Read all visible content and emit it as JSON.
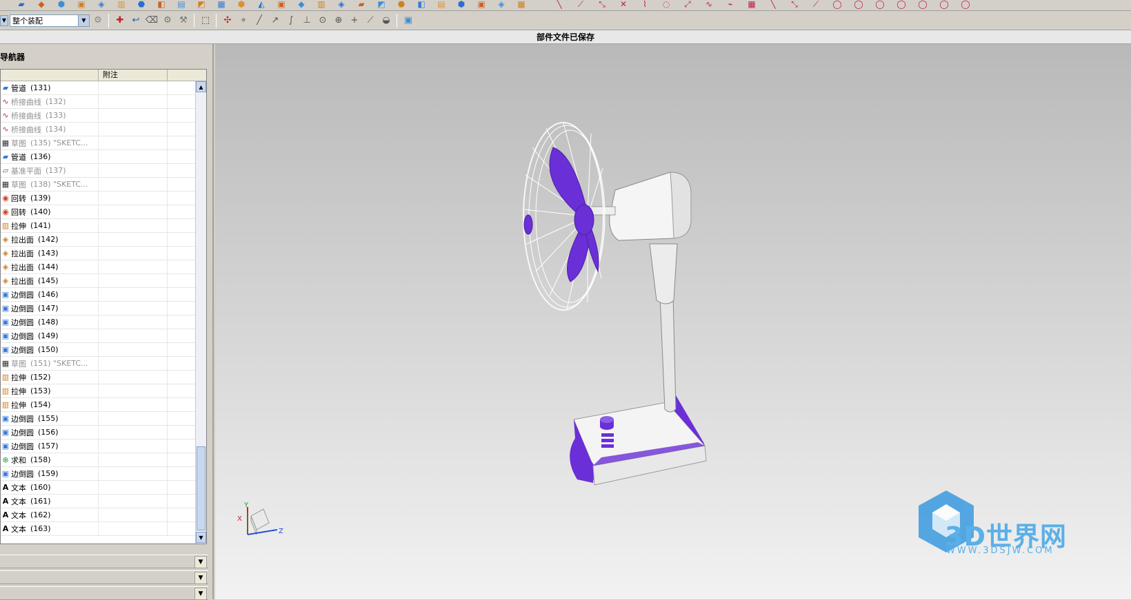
{
  "toolbar": {
    "assembly_scope": "整个装配"
  },
  "status_message": "部件文件已保存",
  "navigator": {
    "title": "导航器",
    "columns": [
      "",
      "附注"
    ],
    "rows": [
      {
        "label": "管道",
        "num": "(131)",
        "dim": false,
        "icon": "pipe-icon"
      },
      {
        "label": "桥接曲线",
        "num": "(132)",
        "dim": true,
        "icon": "bridge-curve-icon"
      },
      {
        "label": "桥接曲线",
        "num": "(133)",
        "dim": true,
        "icon": "bridge-curve-icon"
      },
      {
        "label": "桥接曲线",
        "num": "(134)",
        "dim": true,
        "icon": "bridge-curve-icon"
      },
      {
        "label": "草图",
        "num": "(135) \"SKETC...",
        "dim": true,
        "icon": "sketch-icon"
      },
      {
        "label": "管道",
        "num": "(136)",
        "dim": false,
        "icon": "pipe-icon"
      },
      {
        "label": "基准平面",
        "num": "(137)",
        "dim": true,
        "icon": "datum-plane-icon"
      },
      {
        "label": "草图",
        "num": "(138) \"SKETC...",
        "dim": true,
        "icon": "sketch-icon"
      },
      {
        "label": "回转",
        "num": "(139)",
        "dim": false,
        "icon": "revolve-icon"
      },
      {
        "label": "回转",
        "num": "(140)",
        "dim": false,
        "icon": "revolve-icon"
      },
      {
        "label": "拉伸",
        "num": "(141)",
        "dim": false,
        "icon": "extrude-icon"
      },
      {
        "label": "拉出面",
        "num": "(142)",
        "dim": false,
        "icon": "pull-face-icon"
      },
      {
        "label": "拉出面",
        "num": "(143)",
        "dim": false,
        "icon": "pull-face-icon"
      },
      {
        "label": "拉出面",
        "num": "(144)",
        "dim": false,
        "icon": "pull-face-icon"
      },
      {
        "label": "拉出面",
        "num": "(145)",
        "dim": false,
        "icon": "pull-face-icon"
      },
      {
        "label": "边倒圆",
        "num": "(146)",
        "dim": false,
        "icon": "edge-blend-icon"
      },
      {
        "label": "边倒圆",
        "num": "(147)",
        "dim": false,
        "icon": "edge-blend-icon"
      },
      {
        "label": "边倒圆",
        "num": "(148)",
        "dim": false,
        "icon": "edge-blend-icon"
      },
      {
        "label": "边倒圆",
        "num": "(149)",
        "dim": false,
        "icon": "edge-blend-icon"
      },
      {
        "label": "边倒圆",
        "num": "(150)",
        "dim": false,
        "icon": "edge-blend-icon"
      },
      {
        "label": "草图",
        "num": "(151) \"SKETC...",
        "dim": true,
        "icon": "sketch-icon"
      },
      {
        "label": "拉伸",
        "num": "(152)",
        "dim": false,
        "icon": "extrude-icon"
      },
      {
        "label": "拉伸",
        "num": "(153)",
        "dim": false,
        "icon": "extrude-icon"
      },
      {
        "label": "拉伸",
        "num": "(154)",
        "dim": false,
        "icon": "extrude-icon"
      },
      {
        "label": "边倒圆",
        "num": "(155)",
        "dim": false,
        "icon": "edge-blend-icon"
      },
      {
        "label": "边倒圆",
        "num": "(156)",
        "dim": false,
        "icon": "edge-blend-icon"
      },
      {
        "label": "边倒圆",
        "num": "(157)",
        "dim": false,
        "icon": "edge-blend-icon"
      },
      {
        "label": "求和",
        "num": "(158)",
        "dim": false,
        "icon": "unite-icon"
      },
      {
        "label": "边倒圆",
        "num": "(159)",
        "dim": false,
        "icon": "edge-blend-icon"
      },
      {
        "label": "文本",
        "num": "(160)",
        "dim": false,
        "icon": "text-icon"
      },
      {
        "label": "文本",
        "num": "(161)",
        "dim": false,
        "icon": "text-icon"
      },
      {
        "label": "文本",
        "num": "(162)",
        "dim": false,
        "icon": "text-icon"
      },
      {
        "label": "文本",
        "num": "(163)",
        "dim": false,
        "icon": "text-icon"
      }
    ]
  },
  "triad": {
    "y": "Y",
    "z": "Z",
    "x": "X"
  },
  "watermark": {
    "logo_text": "3D世界网",
    "url": "WWW.3DSJW.COM"
  },
  "colors": {
    "accent_purple": "#6a2fd6",
    "model_white": "#f4f4f4"
  }
}
